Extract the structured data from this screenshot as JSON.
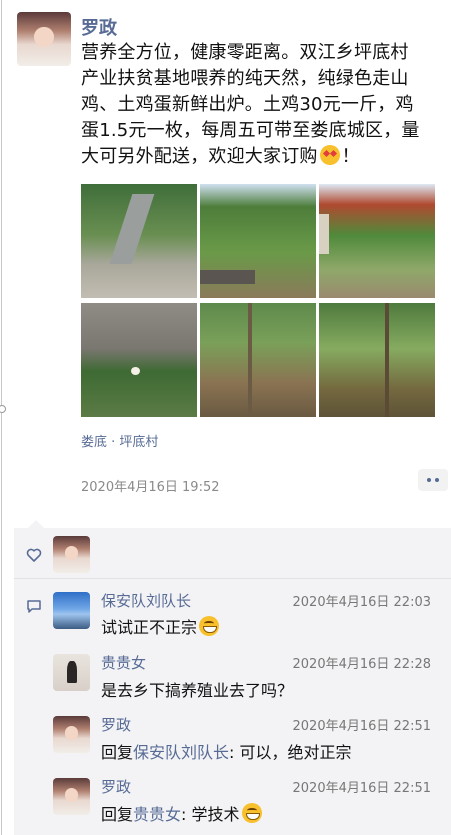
{
  "post": {
    "author": "罗政",
    "text_line1": "营养全方位，健康零距离。双江乡坪底村",
    "text_line2": "产业扶贫基地喂养的纯天然，纯绿色走山",
    "text_line3": "鸡、土鸡蛋新鲜出炉。土鸡30元一斤，鸡",
    "text_line4": "蛋1.5元一枚，每周五可带至娄底城区，量",
    "text_line5": "大可另外配送，欢迎大家订购",
    "text_end": "！",
    "location": "娄底 · 坪底村",
    "time": "2020年4月16日 19:52"
  },
  "comments": [
    {
      "author": "保安队刘队长",
      "time": "2020年4月16日 22:03",
      "text": "试试正不正宗",
      "emoji": "grin"
    },
    {
      "author": "贵贵女",
      "time": "2020年4月16日 22:28",
      "text": "是去乡下搞养殖业去了吗？"
    },
    {
      "author": "罗政",
      "time": "2020年4月16日 22:51",
      "reply_prefix": "回复",
      "reply_to": "保安队刘队长",
      "text": ": 可以，绝对正宗"
    },
    {
      "author": "罗政",
      "time": "2020年4月16日 22:51",
      "reply_prefix": "回复",
      "reply_to": "贵贵女",
      "text": ": 学技术",
      "emoji": "grin"
    }
  ]
}
